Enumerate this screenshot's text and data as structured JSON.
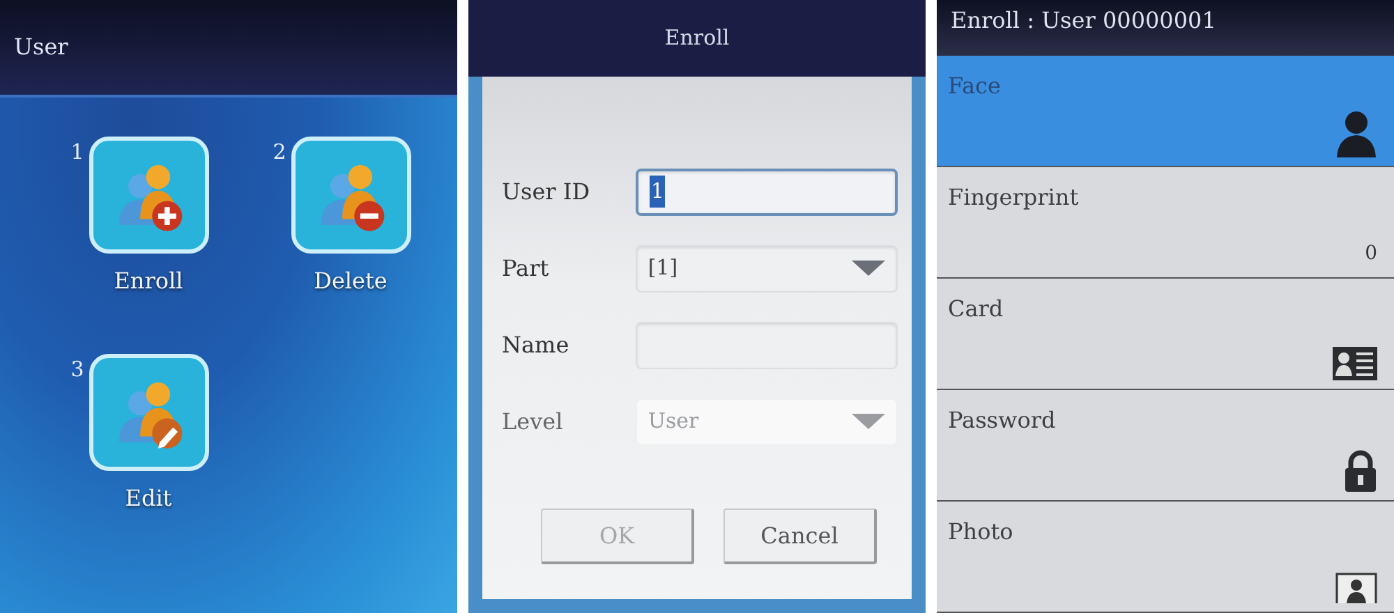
{
  "menu_screen": {
    "title": "User",
    "tiles": [
      {
        "number": "1",
        "label": "Enroll",
        "kind": "add"
      },
      {
        "number": "2",
        "label": "Delete",
        "kind": "remove"
      },
      {
        "number": "3",
        "label": "Edit",
        "kind": "edit"
      }
    ]
  },
  "enroll_dialog": {
    "title": "Enroll",
    "fields": [
      {
        "label": "User ID",
        "kind": "input",
        "value": "1",
        "focused": true,
        "disabled": false
      },
      {
        "label": "Part",
        "kind": "select",
        "value": "[1]",
        "focused": false,
        "disabled": false
      },
      {
        "label": "Name",
        "kind": "input",
        "focused": false,
        "disabled": false
      },
      {
        "label": "Level",
        "kind": "select",
        "value": "User",
        "focused": false,
        "disabled": true
      }
    ],
    "buttons": [
      {
        "label": "OK",
        "disabled": true
      },
      {
        "label": "Cancel",
        "disabled": false
      }
    ]
  },
  "enroll_list": {
    "title": "Enroll : User 00000001",
    "items": [
      {
        "label": "Face",
        "kind": "face",
        "selected": true
      },
      {
        "label": "Fingerprint",
        "kind": "count",
        "value": "0",
        "selected": false
      },
      {
        "label": "Card",
        "kind": "card",
        "selected": false
      },
      {
        "label": "Password",
        "kind": "password",
        "selected": false
      },
      {
        "label": "Photo",
        "kind": "photo",
        "selected": false
      }
    ]
  }
}
